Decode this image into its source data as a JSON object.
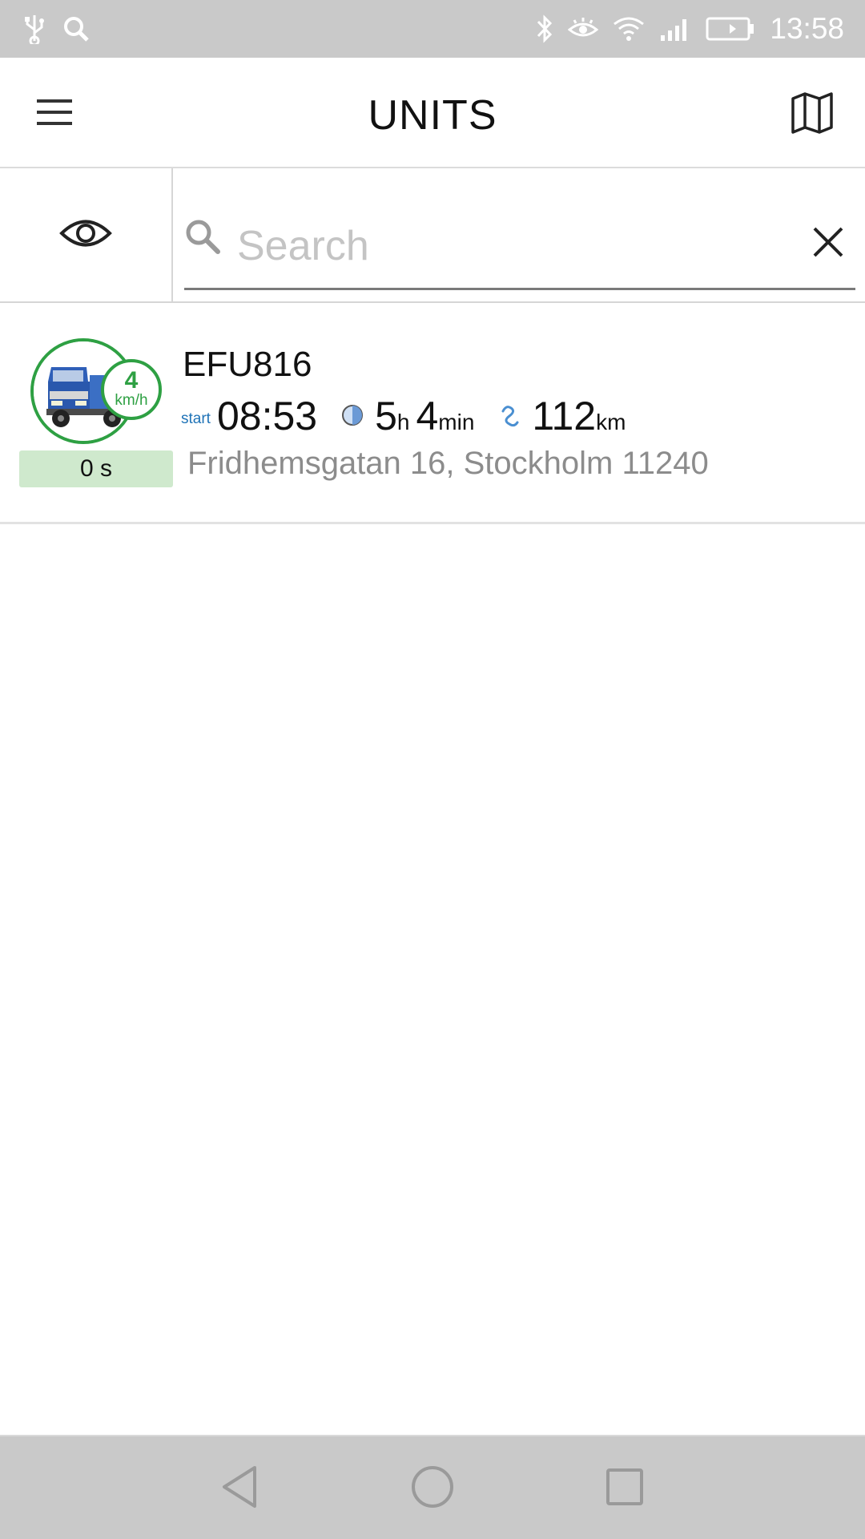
{
  "status_bar": {
    "time": "13:58",
    "icons": [
      "usb-icon",
      "search-icon",
      "bluetooth-icon",
      "eye-comfort-icon",
      "wifi-icon",
      "signal-icon",
      "battery-charging-icon"
    ]
  },
  "app_bar": {
    "title": "UNITS",
    "left_icon": "menu-icon",
    "right_icon": "map-icon"
  },
  "search": {
    "placeholder": "Search",
    "value": "",
    "filter_icon": "eye-icon",
    "clear_icon": "close-icon"
  },
  "units": [
    {
      "name": "EFU816",
      "speed": "4",
      "speed_unit": "km/h",
      "idle_time": "0 s",
      "start_label": "start",
      "start_time": "08:53",
      "duration_hours": "5",
      "duration_hours_unit": "h",
      "duration_minutes": "4",
      "duration_minutes_unit": "min",
      "distance": "112",
      "distance_unit": "km",
      "address": "Fridhemsgatan 16, Stockholm 11240",
      "status_color": "#2ea043"
    }
  ],
  "nav_bar": {
    "buttons": [
      "back-icon",
      "home-icon",
      "recents-icon"
    ]
  }
}
